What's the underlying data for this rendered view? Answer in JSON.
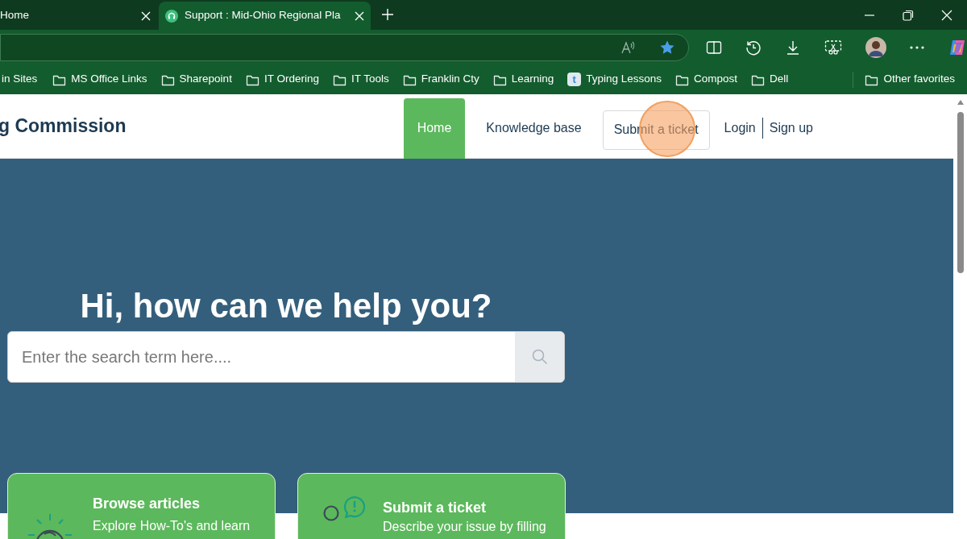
{
  "tabs": [
    {
      "title": "Home",
      "selected": false
    },
    {
      "title": "Support : Mid-Ohio Regional Pla",
      "selected": true
    }
  ],
  "bookmarks": [
    {
      "label": "in Sites",
      "kind": "folder"
    },
    {
      "label": "MS Office Links",
      "kind": "folder"
    },
    {
      "label": "Sharepoint",
      "kind": "folder"
    },
    {
      "label": "IT Ordering",
      "kind": "folder"
    },
    {
      "label": "IT Tools",
      "kind": "folder"
    },
    {
      "label": "Franklin Cty",
      "kind": "folder"
    },
    {
      "label": "Learning",
      "kind": "folder"
    },
    {
      "label": "Typing Lessons",
      "kind": "site",
      "icon_letter": "t"
    },
    {
      "label": "Compost",
      "kind": "folder"
    },
    {
      "label": "Dell",
      "kind": "folder"
    }
  ],
  "other_favorites": "Other favorites",
  "site": {
    "title": "g Commission",
    "nav": [
      {
        "label": "Home",
        "selected": true,
        "kind": "link"
      },
      {
        "label": "Knowledge base",
        "selected": false,
        "kind": "link"
      },
      {
        "label": "Submit a ticket",
        "selected": false,
        "kind": "outlined"
      }
    ],
    "login": "Login",
    "signup": "Sign up"
  },
  "hero": {
    "heading": "Hi, how can we help you?",
    "search": {
      "placeholder": "Enter the search term here...."
    }
  },
  "cards": [
    {
      "kind": "bulb",
      "title": "Browse articles",
      "text": "Explore How-To's and learn"
    },
    {
      "kind": "ticket",
      "title": "Submit a ticket",
      "text": "Describe your issue by filling"
    }
  ]
}
